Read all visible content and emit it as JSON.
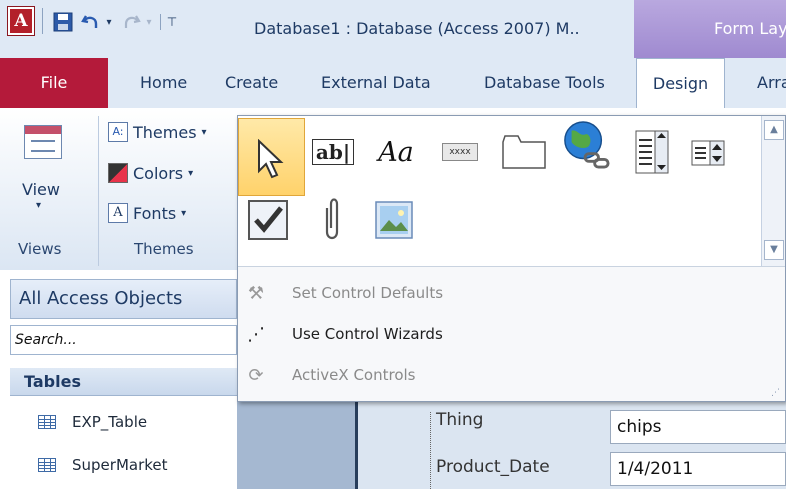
{
  "window": {
    "title": "Database1 : Database (Access 2007) M..",
    "contextual_tab": "Form Lay",
    "app_icon": "A"
  },
  "qat": {
    "icons": [
      "save-icon",
      "undo-icon",
      "redo-icon",
      "customize-icon"
    ]
  },
  "tabs": [
    {
      "label": "File"
    },
    {
      "label": "Home"
    },
    {
      "label": "Create"
    },
    {
      "label": "External Data"
    },
    {
      "label": "Database Tools"
    },
    {
      "label": "Design"
    },
    {
      "label": "Arra"
    }
  ],
  "ribbon": {
    "views": {
      "button_label": "View",
      "group_label": "Views"
    },
    "themes": {
      "items": [
        {
          "label": "Themes",
          "icon": "themes-icon",
          "icon_text": "A:"
        },
        {
          "label": "Colors",
          "icon": "colors-icon"
        },
        {
          "label": "Fonts",
          "icon": "fonts-icon",
          "icon_text": "A"
        }
      ],
      "group_label": "Themes"
    }
  },
  "gallery": {
    "controls": [
      {
        "name": "select-control",
        "icon": "pointer-icon"
      },
      {
        "name": "text-box-control",
        "icon": "textbox-icon",
        "text": "ab|"
      },
      {
        "name": "label-control",
        "icon": "label-icon",
        "text": "Aa"
      },
      {
        "name": "button-control",
        "icon": "button-icon",
        "text": "xxxx"
      },
      {
        "name": "tab-control",
        "icon": "tab-control-icon"
      },
      {
        "name": "hyperlink-control",
        "icon": "hyperlink-globe-icon"
      },
      {
        "name": "list-box-control",
        "icon": "listbox-icon"
      },
      {
        "name": "combo-box-control",
        "icon": "combobox-icon"
      },
      {
        "name": "check-box-control",
        "icon": "checkbox-icon"
      },
      {
        "name": "attachment-control",
        "icon": "paperclip-icon"
      },
      {
        "name": "image-control",
        "icon": "image-icon"
      }
    ],
    "menu": [
      {
        "label": "Set Control Defaults",
        "icon": "set-defaults-icon",
        "enabled": false
      },
      {
        "label": "Use Control Wizards",
        "icon": "wizard-wand-icon",
        "enabled": true
      },
      {
        "label": "ActiveX Controls",
        "icon": "activex-icon",
        "enabled": false
      }
    ]
  },
  "nav_pane": {
    "header": "All Access Objects",
    "search_placeholder": "Search...",
    "group": "Tables",
    "items": [
      {
        "label": "EXP_Table"
      },
      {
        "label": "SuperMarket"
      }
    ]
  },
  "form": {
    "fields": [
      {
        "label": "Thing",
        "value": "chips"
      },
      {
        "label": "Product_Date",
        "value": "1/4/2011"
      }
    ]
  }
}
